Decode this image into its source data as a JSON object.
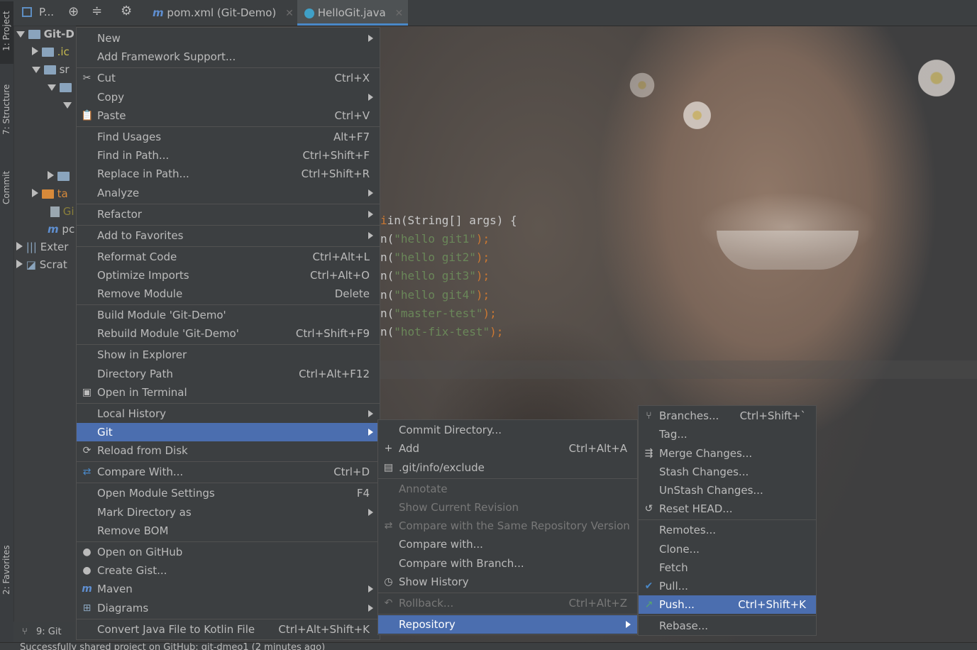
{
  "tool_windows": {
    "project": "1: Project",
    "structure": "7: Structure",
    "commit": "Commit",
    "favorites": "2: Favorites",
    "git": "9: Git"
  },
  "toolbar": {
    "project_selector": "P..."
  },
  "tabs": [
    {
      "label": "pom.xml (Git-Demo)",
      "icon": "maven-icon"
    },
    {
      "label": "HelloGit.java",
      "icon": "java-class-icon"
    }
  ],
  "tree": {
    "root": "Git-D",
    "items": [
      ".ic",
      "sr",
      "",
      "",
      "",
      "ta",
      "Gi",
      "pc",
      "Exter",
      "Scrat"
    ]
  },
  "code": {
    "signature": "in(String[] args) {",
    "lines": [
      {
        "pre": "n(",
        "str": "\"hello git1\"",
        "post": ");"
      },
      {
        "pre": "n(",
        "str": "\"hello git2\"",
        "post": ");"
      },
      {
        "pre": "n(",
        "str": "\"hello git3\"",
        "post": ");"
      },
      {
        "pre": "n(",
        "str": "\"hello git4\"",
        "post": ");"
      },
      {
        "pre": "n(",
        "str": "\"master-test\"",
        "post": ");"
      },
      {
        "pre": "n(",
        "str": "\"hot-fix-test\"",
        "post": ");"
      }
    ]
  },
  "context_menu": {
    "items": {
      "new": "New",
      "add_framework": "Add Framework Support...",
      "cut": "Cut",
      "cut_sc": "Ctrl+X",
      "copy": "Copy",
      "paste": "Paste",
      "paste_sc": "Ctrl+V",
      "find_usages": "Find Usages",
      "find_usages_sc": "Alt+F7",
      "find_in_path": "Find in Path...",
      "find_in_path_sc": "Ctrl+Shift+F",
      "replace_in_path": "Replace in Path...",
      "replace_in_path_sc": "Ctrl+Shift+R",
      "analyze": "Analyze",
      "refactor": "Refactor",
      "add_to_favorites": "Add to Favorites",
      "reformat_code": "Reformat Code",
      "reformat_code_sc": "Ctrl+Alt+L",
      "optimize_imports": "Optimize Imports",
      "optimize_imports_sc": "Ctrl+Alt+O",
      "remove_module": "Remove Module",
      "remove_module_sc": "Delete",
      "build_module": "Build Module 'Git-Demo'",
      "rebuild_module": "Rebuild Module 'Git-Demo'",
      "rebuild_module_sc": "Ctrl+Shift+F9",
      "show_in_explorer": "Show in Explorer",
      "directory_path": "Directory Path",
      "directory_path_sc": "Ctrl+Alt+F12",
      "open_in_terminal": "Open in Terminal",
      "local_history": "Local History",
      "git": "Git",
      "reload_from_disk": "Reload from Disk",
      "compare_with": "Compare With...",
      "compare_with_sc": "Ctrl+D",
      "open_module_settings": "Open Module Settings",
      "open_module_settings_sc": "F4",
      "mark_directory_as": "Mark Directory as",
      "remove_bom": "Remove BOM",
      "open_on_github": "Open on GitHub",
      "create_gist": "Create Gist...",
      "maven": "Maven",
      "diagrams": "Diagrams",
      "convert_java_kotlin": "Convert Java File to Kotlin File",
      "convert_java_kotlin_sc": "Ctrl+Alt+Shift+K"
    }
  },
  "git_menu": {
    "commit_directory": "Commit Directory...",
    "add": "Add",
    "add_sc": "Ctrl+Alt+A",
    "git_info_exclude": ".git/info/exclude",
    "annotate": "Annotate",
    "show_current_revision": "Show Current Revision",
    "compare_same_repo": "Compare with the Same Repository Version",
    "compare_with": "Compare with...",
    "compare_with_branch": "Compare with Branch...",
    "show_history": "Show History",
    "rollback": "Rollback...",
    "rollback_sc": "Ctrl+Alt+Z",
    "repository": "Repository"
  },
  "repository_menu": {
    "branches": "Branches...",
    "branches_sc": "Ctrl+Shift+`",
    "tag": "Tag...",
    "merge_changes": "Merge Changes...",
    "stash_changes": "Stash Changes...",
    "unstash_changes": "UnStash Changes...",
    "reset_head": "Reset HEAD...",
    "remotes": "Remotes...",
    "clone": "Clone...",
    "fetch": "Fetch",
    "pull": "Pull...",
    "push": "Push...",
    "push_sc": "Ctrl+Shift+K",
    "rebase": "Rebase..."
  },
  "status": {
    "message": "Successfully shared project on GitHub: git-dmeo1 (2 minutes ago)"
  },
  "colors": {
    "menu_bg": "#3c3f41",
    "selection": "#4b6eaf",
    "string": "#6a8759",
    "keyword": "#cc7832"
  }
}
